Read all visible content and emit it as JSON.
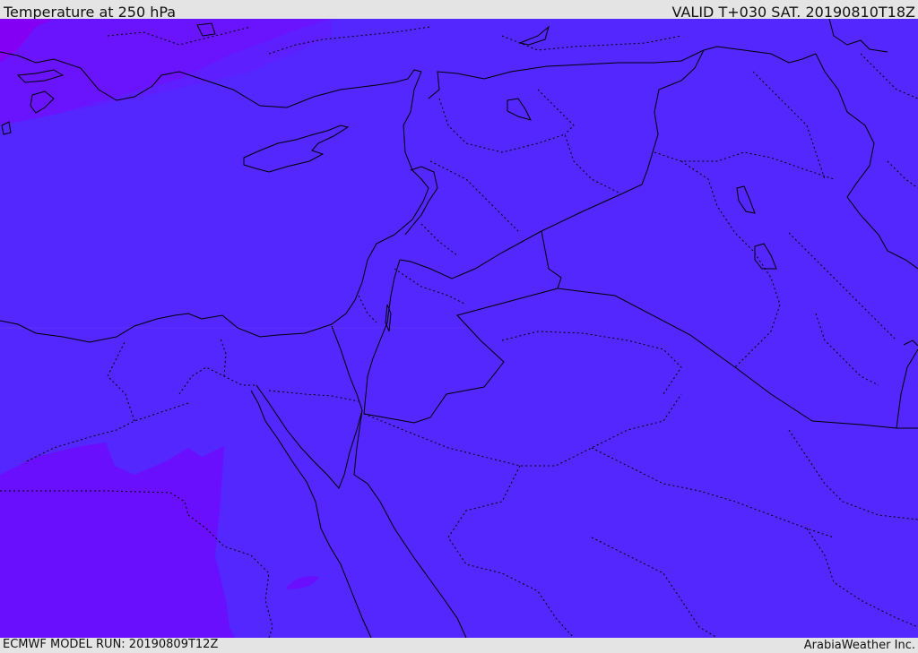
{
  "header": {
    "title": "Temperature at 250 hPa",
    "valid": "VALID T+030 SAT. 20190810T18Z"
  },
  "footer": {
    "model_run": "ECMWF MODEL RUN: 20190809T12Z",
    "credit": "ArabiaWeather Inc."
  },
  "colors": {
    "main_field": "#5427ff",
    "warm_field": "#6a0ffe",
    "northwest_field": "#6619fe",
    "hot_corner": "#8400f5",
    "boundary_line": "#000000"
  }
}
